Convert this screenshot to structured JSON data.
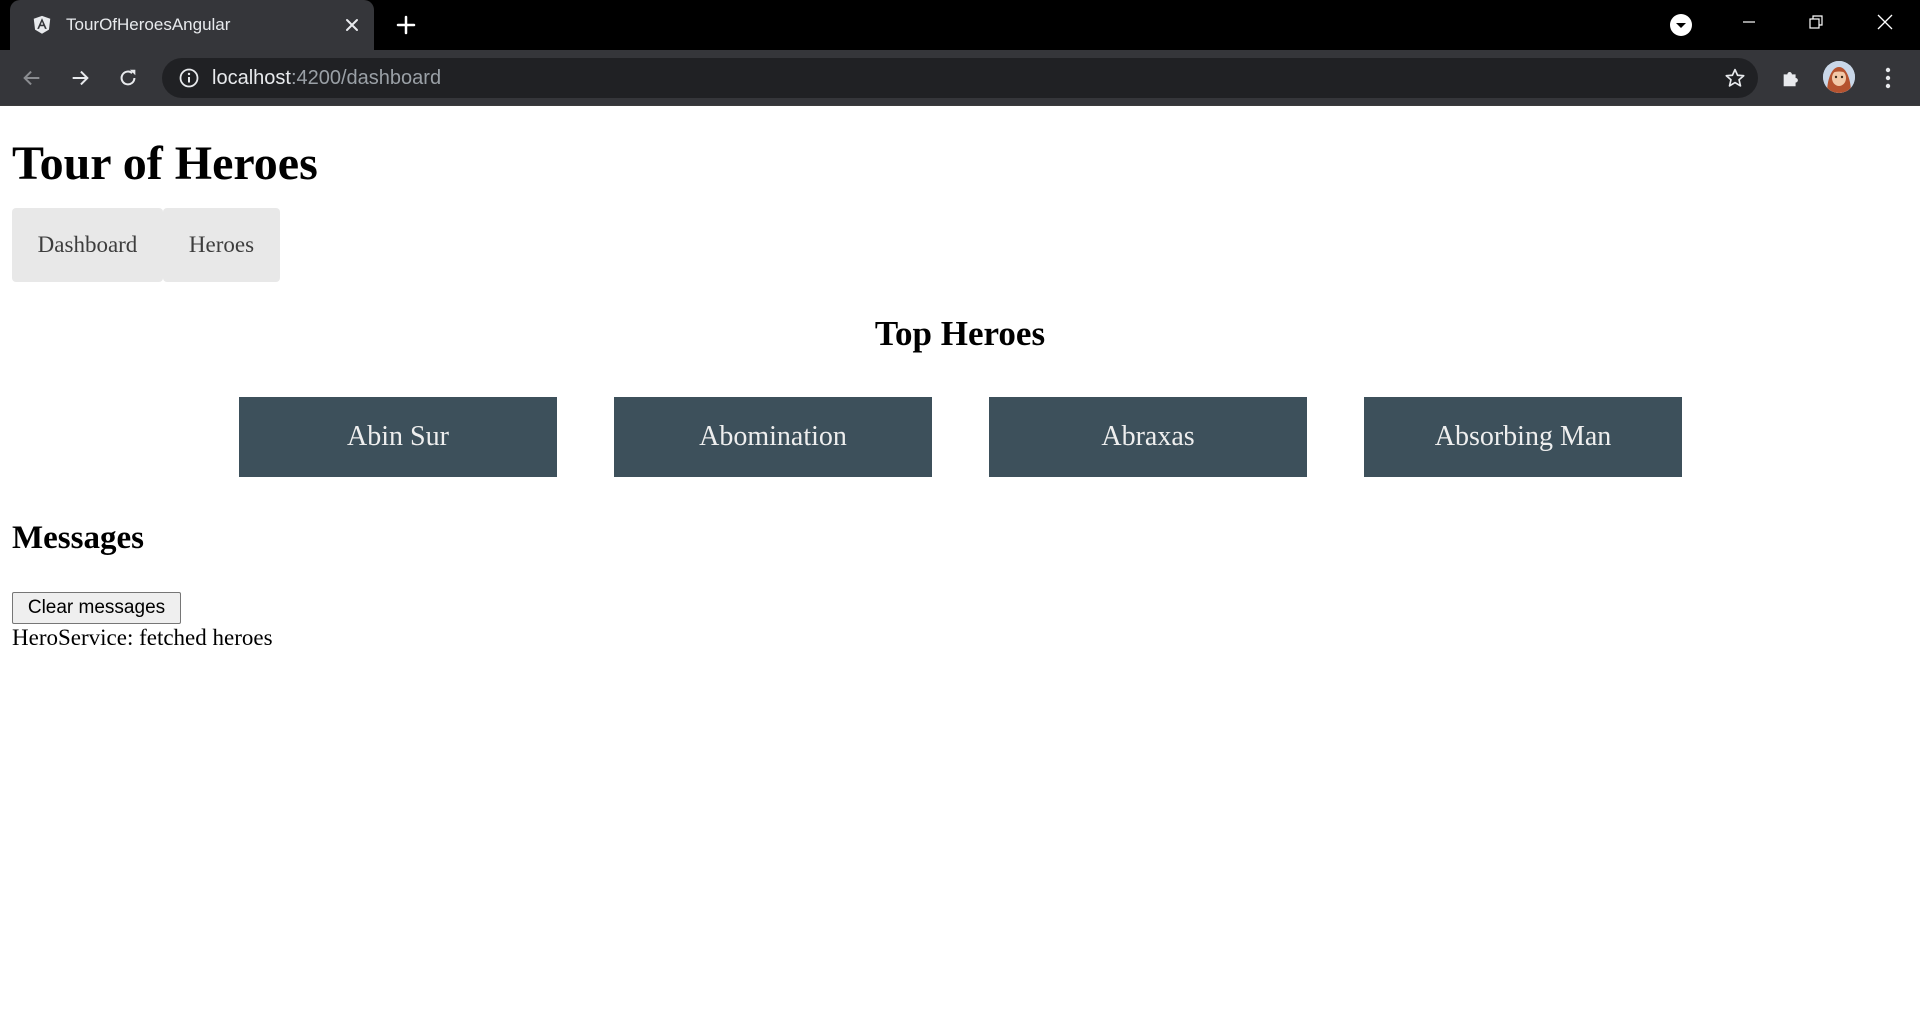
{
  "browser": {
    "tab_title": "TourOfHeroesAngular",
    "url_host": "localhost",
    "url_rest": ":4200/dashboard",
    "icons": {
      "favicon": "angular-icon",
      "tab_close": "close-icon",
      "new_tab": "plus-icon",
      "profile_menu": "chevron-down-icon",
      "minimize": "minimize-icon",
      "restore": "restore-icon",
      "close_window": "close-icon",
      "back": "arrow-left-icon",
      "forward": "arrow-right-icon",
      "reload": "reload-icon",
      "site_info": "info-icon",
      "bookmark": "star-icon",
      "extensions": "puzzle-icon",
      "menu": "kebab-menu-icon"
    }
  },
  "app": {
    "title": "Tour of Heroes",
    "nav": {
      "dashboard_label": "Dashboard",
      "heroes_label": "Heroes"
    },
    "top_heroes_title": "Top Heroes",
    "heroes": [
      {
        "name": "Abin Sur"
      },
      {
        "name": "Abomination"
      },
      {
        "name": "Abraxas"
      },
      {
        "name": "Absorbing Man"
      }
    ],
    "messages": {
      "title": "Messages",
      "clear_label": "Clear messages",
      "items": [
        "HeroService: fetched heroes"
      ]
    }
  },
  "colors": {
    "hero_card_bg": "#3d505b",
    "nav_button_bg": "#e8e8e8",
    "chrome_toolbar": "#35363a",
    "tabstrip": "#000000"
  }
}
